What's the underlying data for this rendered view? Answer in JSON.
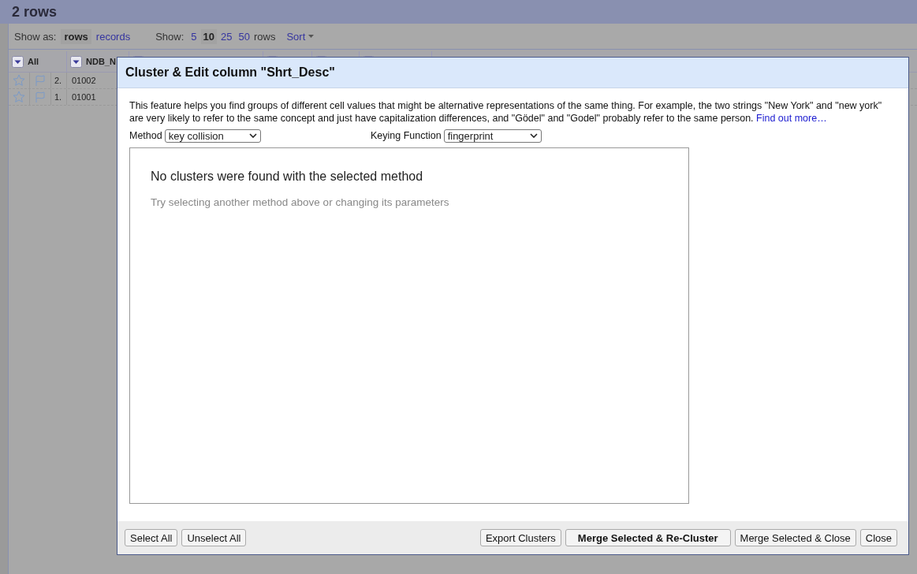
{
  "header": {
    "title": "2 rows"
  },
  "toolbar": {
    "show_as_label": "Show as:",
    "show_as": [
      {
        "label": "rows",
        "selected": true
      },
      {
        "label": "records",
        "selected": false
      }
    ],
    "show_label": "Show:",
    "page_sizes": [
      {
        "label": "5",
        "selected": false
      },
      {
        "label": "10",
        "selected": true
      },
      {
        "label": "25",
        "selected": false
      },
      {
        "label": "50",
        "selected": false
      }
    ],
    "rows_label": "rows",
    "sort": "Sort"
  },
  "table": {
    "columns": [
      "All",
      "NDB_N"
    ],
    "rows": [
      {
        "starred": false,
        "flagged": false,
        "index": "2.",
        "cell": "01002"
      },
      {
        "starred": false,
        "flagged": false,
        "index": "1.",
        "cell": "01001"
      }
    ]
  },
  "dialog": {
    "title": "Cluster & Edit column \"Shrt_Desc\"",
    "description": "This feature helps you find groups of different cell values that might be alternative representations of the same thing. For example, the two strings \"New York\" and \"new york\" are very likely to refer to the same concept and just have capitalization differences, and \"Gödel\" and \"Godel\" probably refer to the same person.",
    "link": "Find out more…",
    "method": {
      "label": "Method",
      "value": "key collision"
    },
    "keying_function": {
      "label": "Keying Function",
      "value": "fingerprint"
    },
    "empty_title": "No clusters were found with the selected method",
    "empty_hint": "Try selecting another method above or changing its parameters",
    "left_buttons": [
      {
        "label": "Select All",
        "primary": false
      },
      {
        "label": "Unselect All",
        "primary": false
      }
    ],
    "right_buttons": [
      {
        "label": "Export Clusters",
        "primary": false
      },
      {
        "label": "Merge Selected & Re-Cluster",
        "primary": true
      },
      {
        "label": "Merge Selected & Close",
        "primary": false
      },
      {
        "label": "Close",
        "primary": false
      }
    ]
  }
}
